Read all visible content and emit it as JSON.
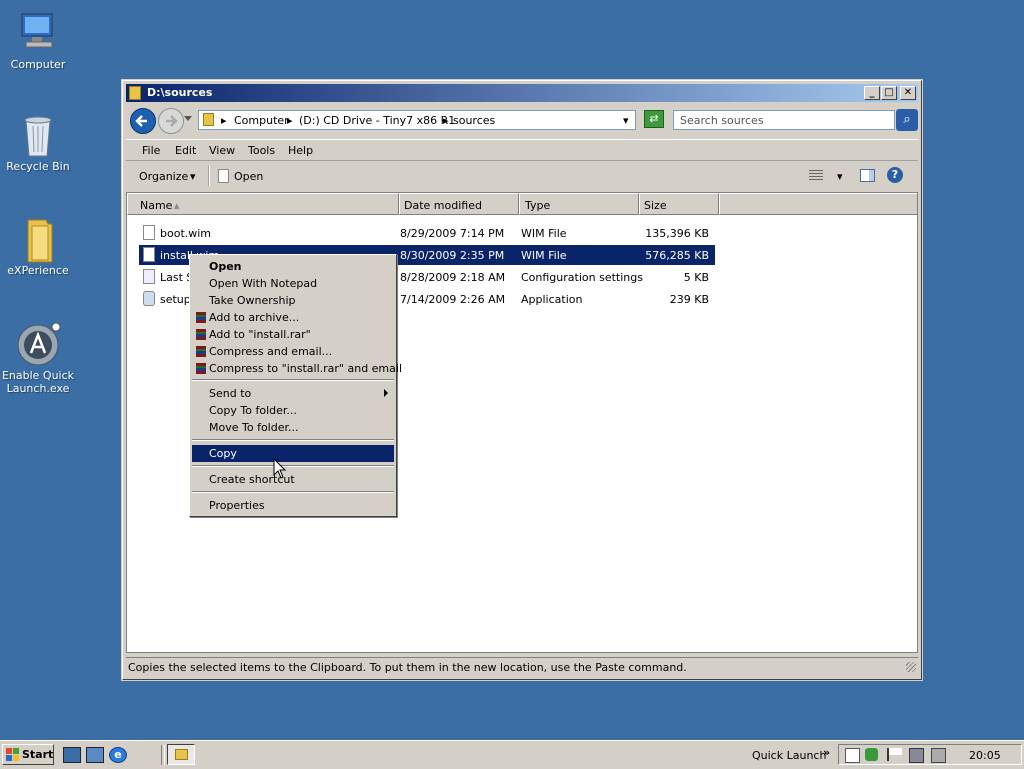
{
  "desktop": {
    "icons": [
      {
        "label1": "Computer",
        "label2": ""
      },
      {
        "label1": "Recycle Bin",
        "label2": ""
      },
      {
        "label1": "eXPerience",
        "label2": ""
      },
      {
        "label1": "Enable Quick",
        "label2": "Launch.exe"
      }
    ]
  },
  "window": {
    "title": "D:\\sources",
    "controls": {
      "minimize": "_",
      "maximize": "□",
      "close": "✕"
    },
    "address": {
      "segments": [
        "Computer",
        "(D:) CD Drive - Tiny7 x86 R1",
        "sources"
      ],
      "separator": "▸",
      "dropdown": "▾"
    },
    "search": {
      "placeholder": "Search sources"
    },
    "menu": [
      "File",
      "Edit",
      "View",
      "Tools",
      "Help"
    ],
    "commands": {
      "organize": "Organize",
      "organize_arrow": "▾",
      "open": "Open",
      "views_arrow": "▾",
      "help": "?"
    },
    "columns": [
      "Name",
      "Date modified",
      "Type",
      "Size"
    ],
    "sort_indicator": "▴",
    "files": [
      {
        "name": "boot.wim",
        "date": "8/29/2009 7:14 PM",
        "type": "WIM File",
        "size": "135,396 KB",
        "selected": false
      },
      {
        "name": "install.wim",
        "date": "8/30/2009 2:35 PM",
        "type": "WIM File",
        "size": "576,285 KB",
        "selected": true
      },
      {
        "name": "Last S",
        "date": "8/28/2009 2:18 AM",
        "type": "Configuration settings",
        "size": "5 KB",
        "selected": false
      },
      {
        "name": "setup",
        "date": "7/14/2009 2:26 AM",
        "type": "Application",
        "size": "239 KB",
        "selected": false
      }
    ],
    "status": "Copies the selected items to the Clipboard. To put them in the new location, use the Paste command."
  },
  "context_menu": {
    "items": [
      {
        "label": "Open",
        "bold": true
      },
      {
        "label": "Open With Notepad"
      },
      {
        "label": "Take Ownership"
      },
      {
        "label": "Add to archive...",
        "icon": "winrar-icon"
      },
      {
        "label": "Add to \"install.rar\"",
        "icon": "winrar-icon"
      },
      {
        "label": "Compress and email...",
        "icon": "winrar-icon"
      },
      {
        "label": "Compress to \"install.rar\" and email",
        "icon": "winrar-icon"
      },
      {
        "label": "Send to",
        "submenu": true
      },
      {
        "label": "Copy To folder..."
      },
      {
        "label": "Move To folder..."
      },
      {
        "label": "Copy",
        "highlighted": true
      },
      {
        "label": "Create shortcut"
      },
      {
        "label": "Properties"
      }
    ]
  },
  "taskbar": {
    "start": "Start",
    "quick_launch_label": "Quick Launch",
    "chevron": "»",
    "clock": "20:05"
  }
}
